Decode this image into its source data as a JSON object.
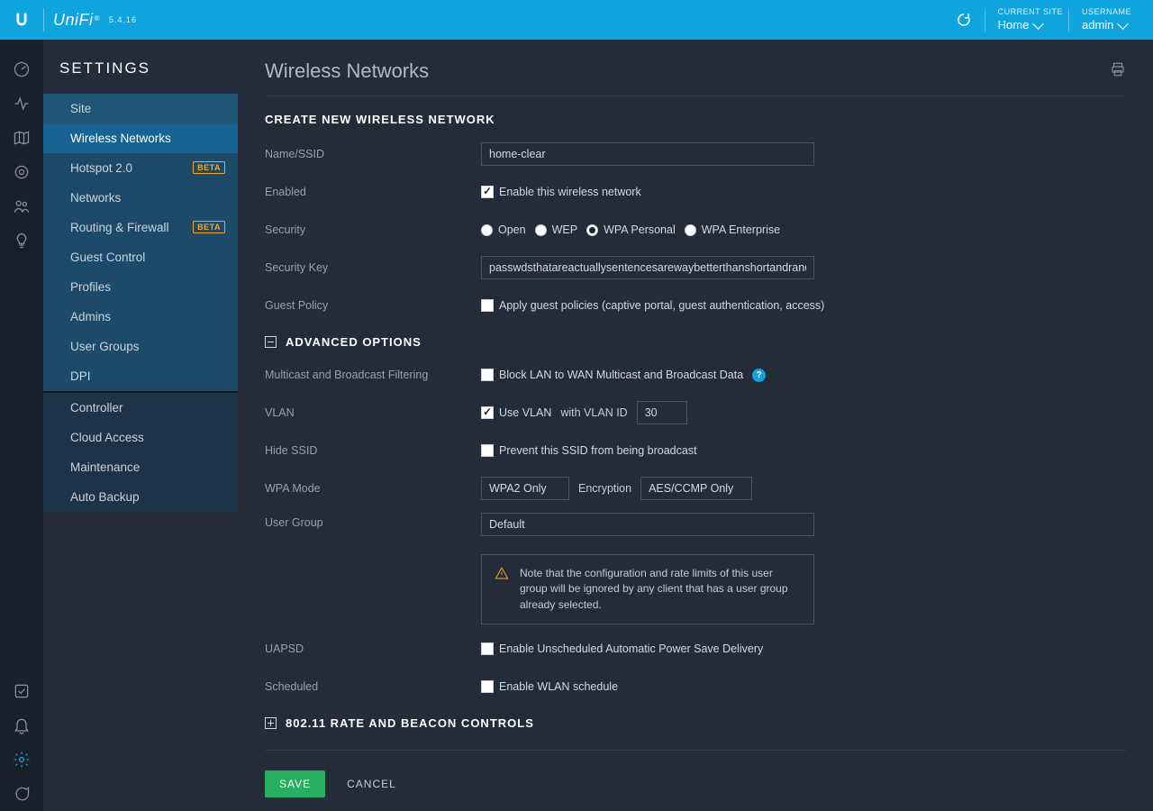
{
  "brand": {
    "name": "UniFi",
    "version": "5.4.16"
  },
  "topbar": {
    "site_label": "CURRENT SITE",
    "site_value": "Home",
    "user_label": "USERNAME",
    "user_value": "admin"
  },
  "settings_title": "SETTINGS",
  "menu": [
    {
      "label": "Site",
      "beta": false
    },
    {
      "label": "Wireless Networks",
      "beta": false
    },
    {
      "label": "Hotspot 2.0",
      "beta": true
    },
    {
      "label": "Networks",
      "beta": false
    },
    {
      "label": "Routing & Firewall",
      "beta": true
    },
    {
      "label": "Guest Control",
      "beta": false
    },
    {
      "label": "Profiles",
      "beta": false
    },
    {
      "label": "Admins",
      "beta": false
    },
    {
      "label": "User Groups",
      "beta": false
    },
    {
      "label": "DPI",
      "beta": false
    }
  ],
  "menu2": [
    {
      "label": "Controller"
    },
    {
      "label": "Cloud Access"
    },
    {
      "label": "Maintenance"
    },
    {
      "label": "Auto Backup"
    }
  ],
  "beta_label": "BETA",
  "page_title": "Wireless Networks",
  "create_title": "CREATE NEW WIRELESS NETWORK",
  "fields": {
    "name_label": "Name/SSID",
    "name_value": "home-clear",
    "enabled_label": "Enabled",
    "enabled_cb": "Enable this wireless network",
    "security_label": "Security",
    "sec_open": "Open",
    "sec_wep": "WEP",
    "sec_wpap": "WPA Personal",
    "sec_wpae": "WPA Enterprise",
    "seckey_label": "Security Key",
    "seckey_value": "passwdsthatareactuallysentencesarewaybetterthanshortandrandom",
    "guest_label": "Guest Policy",
    "guest_cb": "Apply guest policies (captive portal, guest authentication, access)"
  },
  "adv_title": "ADVANCED OPTIONS",
  "adv": {
    "mcast_label": "Multicast and Broadcast Filtering",
    "mcast_cb": "Block LAN to WAN Multicast and Broadcast Data",
    "vlan_label": "VLAN",
    "vlan_cb": "Use VLAN",
    "vlan_with": "with VLAN ID",
    "vlan_id": "30",
    "hide_label": "Hide SSID",
    "hide_cb": "Prevent this SSID from being broadcast",
    "wpamode_label": "WPA Mode",
    "wpamode_value": "WPA2 Only",
    "enc_label": "Encryption",
    "enc_value": "AES/CCMP Only",
    "ugroup_label": "User Group",
    "ugroup_value": "Default",
    "note": "Note that the configuration and rate limits of this user group will be ignored by any client that has a user group already selected.",
    "uapsd_label": "UAPSD",
    "uapsd_cb": "Enable Unscheduled Automatic Power Save Delivery",
    "sched_label": "Scheduled",
    "sched_cb": "Enable WLAN schedule"
  },
  "rate_title": "802.11 RATE AND BEACON CONTROLS",
  "btn_save": "SAVE",
  "btn_cancel": "CANCEL"
}
